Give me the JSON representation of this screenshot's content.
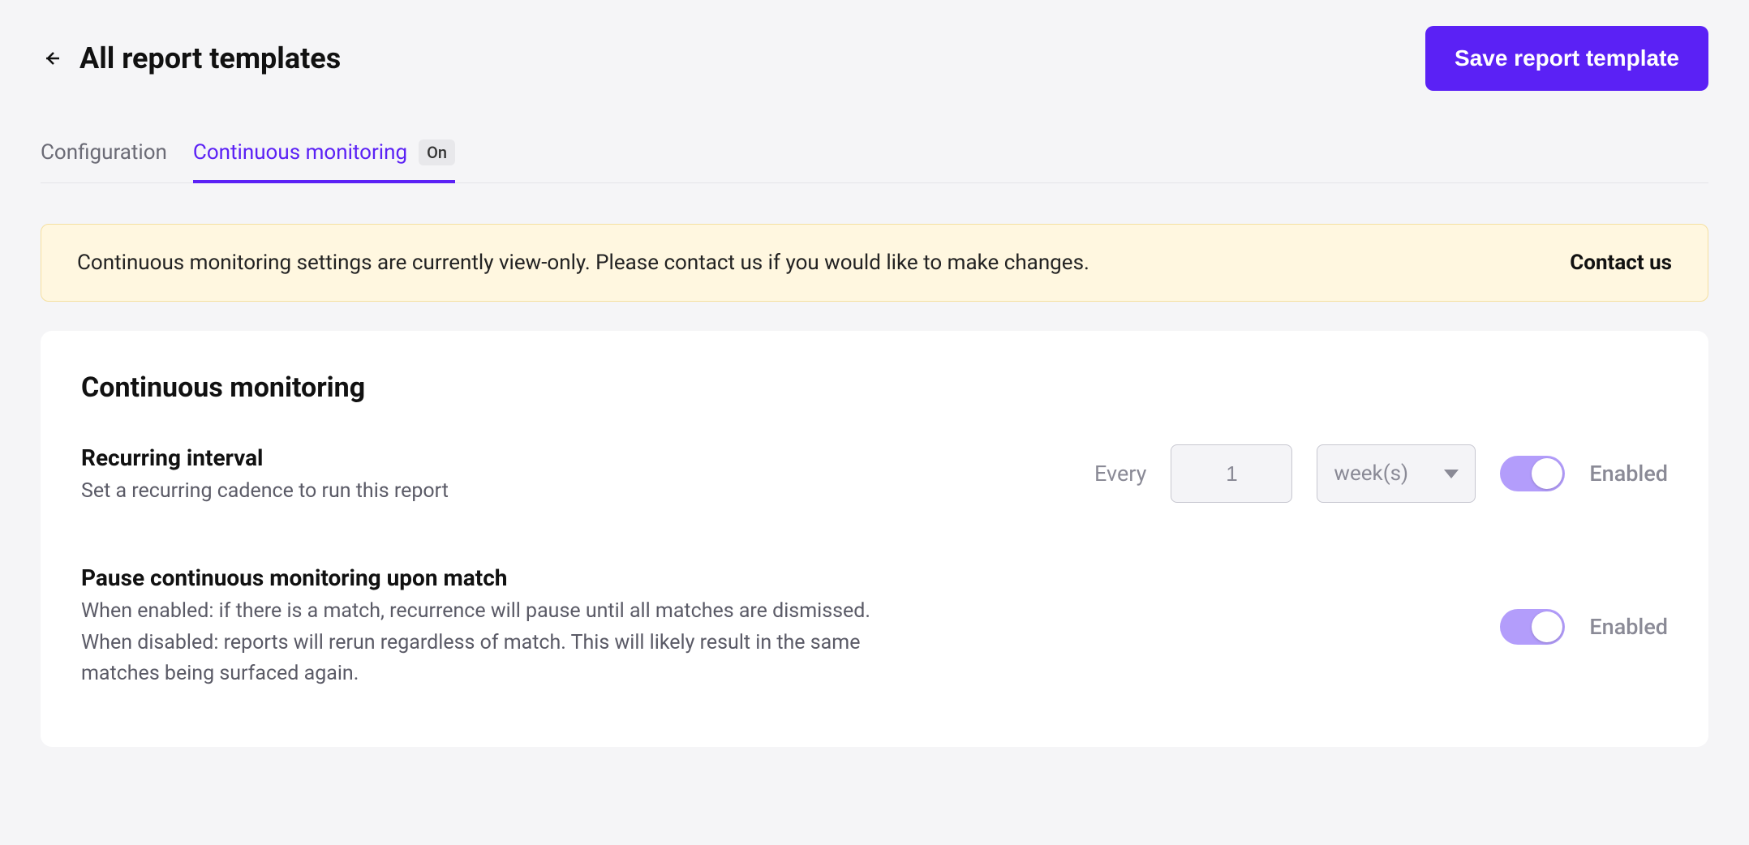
{
  "header": {
    "title": "All report templates",
    "save_label": "Save report template"
  },
  "tabs": {
    "configuration_label": "Configuration",
    "monitoring_label": "Continuous monitoring",
    "monitoring_badge": "On"
  },
  "banner": {
    "text": "Continuous monitoring settings are currently view-only. Please contact us if you would like to make changes.",
    "link_label": "Contact us"
  },
  "card": {
    "title": "Continuous monitoring",
    "recurring": {
      "title": "Recurring interval",
      "desc": "Set a recurring cadence to run this report",
      "every_label": "Every",
      "value": "1",
      "unit": "week(s)",
      "toggle_label": "Enabled"
    },
    "pause": {
      "title": "Pause continuous monitoring upon match",
      "desc": "When enabled: if there is a match, recurrence will pause until all matches are dismissed.\nWhen disabled: reports will rerun regardless of match. This will likely result in the same matches being surfaced again.",
      "toggle_label": "Enabled"
    }
  },
  "colors": {
    "accent": "#5b21f5",
    "toggle_on": "#b39dfb",
    "banner_bg": "#fff7e0",
    "banner_border": "#f5e0a0"
  }
}
